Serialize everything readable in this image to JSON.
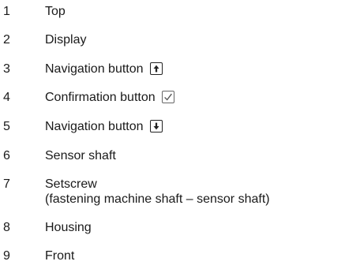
{
  "legend": {
    "items": [
      {
        "num": "1",
        "label": "Top"
      },
      {
        "num": "2",
        "label": "Display"
      },
      {
        "num": "3",
        "label": "Navigation button",
        "icon": "arrow-up-icon"
      },
      {
        "num": "4",
        "label": "Confirmation button",
        "icon": "checkmark-icon"
      },
      {
        "num": "5",
        "label": "Navigation button",
        "icon": "arrow-down-icon"
      },
      {
        "num": "6",
        "label": "Sensor shaft"
      },
      {
        "num": "7",
        "label": "Setscrew",
        "sublabel": "(fastening machine shaft – sensor shaft)"
      },
      {
        "num": "8",
        "label": "Housing"
      },
      {
        "num": "9",
        "label": "Front"
      }
    ]
  }
}
